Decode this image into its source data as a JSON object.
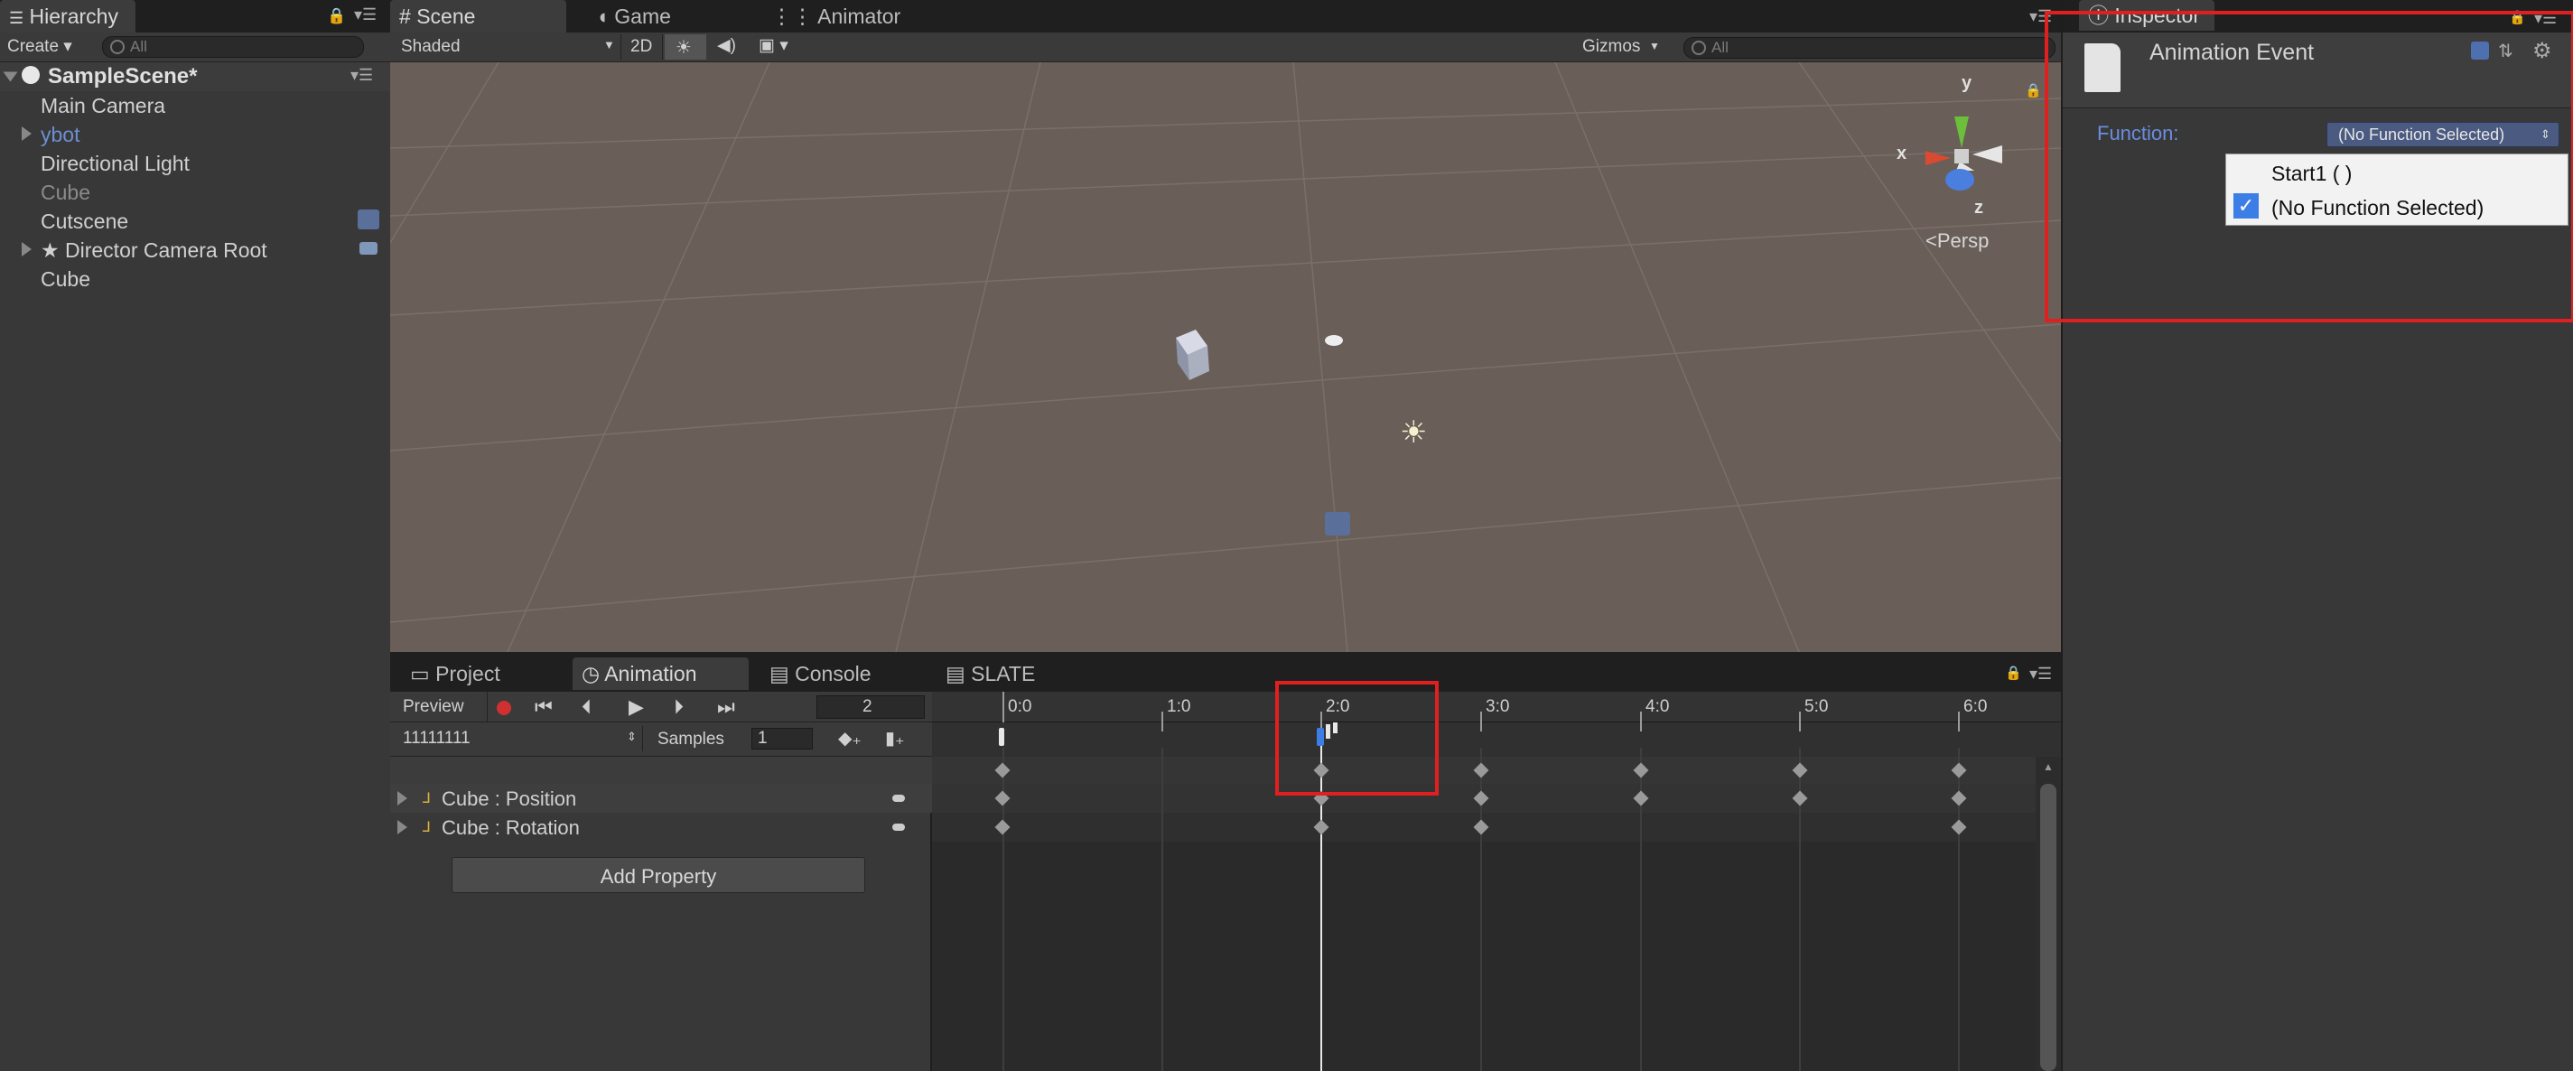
{
  "hierarchy": {
    "tab": "Hierarchy",
    "create": "Create",
    "search_placeholder": "All",
    "scene": "SampleScene*",
    "items": [
      {
        "label": "Main Camera"
      },
      {
        "label": "ybot"
      },
      {
        "label": "Directional Light"
      },
      {
        "label": "Cube"
      },
      {
        "label": "Cutscene"
      },
      {
        "label": "★ Director Camera Root"
      },
      {
        "label": "Cube"
      }
    ]
  },
  "scene_tabs": {
    "scene": "Scene",
    "game": "Game",
    "animator": "Animator"
  },
  "scene_toolbar": {
    "shading": "Shaded",
    "mode_2d": "2D",
    "gizmos": "Gizmos",
    "search_placeholder": "All"
  },
  "gizmo": {
    "y": "y",
    "x": "x",
    "z": "z",
    "persp": "Persp"
  },
  "bottom_tabs": {
    "project": "Project",
    "animation": "Animation",
    "console": "Console",
    "slate": "SLATE"
  },
  "animation": {
    "preview": "Preview",
    "frame": "2",
    "clip": "11111111",
    "samples_label": "Samples",
    "samples": "1",
    "properties": [
      {
        "label": "Cube : Position"
      },
      {
        "label": "Cube : Rotation"
      }
    ],
    "add_property": "Add Property",
    "ruler": [
      "0:0",
      "1:0",
      "2:0",
      "3:0",
      "4:0",
      "5:0",
      "6:0"
    ]
  },
  "inspector": {
    "tab": "Inspector",
    "title": "Animation Event",
    "function_label": "Function:",
    "selected": "(No Function Selected)",
    "options": [
      {
        "label": "Start1 ( )",
        "checked": false
      },
      {
        "label": "(No Function Selected)",
        "checked": true
      }
    ]
  },
  "colors": {
    "highlight": "#e02020",
    "accent": "#3d7ee6",
    "scene_bg": "#695e58"
  }
}
